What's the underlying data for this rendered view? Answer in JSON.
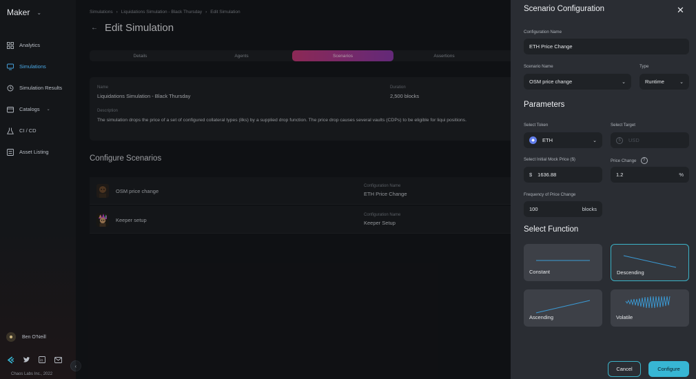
{
  "app": {
    "name": "Maker"
  },
  "sidebar": {
    "items": [
      {
        "label": "Analytics",
        "icon": "analytics-icon"
      },
      {
        "label": "Simulations",
        "icon": "monitor-icon",
        "active": true
      },
      {
        "label": "Simulation Results",
        "icon": "history-icon"
      },
      {
        "label": "Catalogs",
        "icon": "catalog-icon",
        "expandable": true
      },
      {
        "label": "CI / CD",
        "icon": "flask-icon"
      },
      {
        "label": "Asset Listing",
        "icon": "listing-icon"
      }
    ],
    "user": {
      "name": "Ben O'Neill"
    },
    "copyright": "Chaos Labs Inc., 2022"
  },
  "breadcrumb": [
    "Simulations",
    "Liquidations Simulation - Black Thursday",
    "Edit Simulation"
  ],
  "page": {
    "title": "Edit Simulation"
  },
  "tabs": [
    {
      "label": "Details"
    },
    {
      "label": "Agents"
    },
    {
      "label": "Scenarios",
      "active": true
    },
    {
      "label": "Assertions"
    }
  ],
  "details": {
    "name_label": "Name",
    "name_value": "Liquidations Simulation - Black Thursday",
    "duration_label": "Duration",
    "duration_value": "2,500 blocks",
    "description_label": "Description",
    "description_value": "The simulation drops the price of a set of configured collateral types (ilks) by a supplied drop function. The price drop causes several vaults (CDPs) to be eligible for liqui positions."
  },
  "configure_scenarios": {
    "title": "Configure Scenarios",
    "rows": [
      {
        "name": "OSM price change",
        "config_label": "Configuration Name",
        "config_value": "ETH Price Change"
      },
      {
        "name": "Keeper setup",
        "config_label": "Configuration Name",
        "config_value": "Keeper Setup"
      }
    ]
  },
  "drawer": {
    "title": "Scenario Configuration",
    "config_name_label": "Configuration Name",
    "config_name_value": "ETH Price Change",
    "scenario_name_label": "Scenario Name",
    "scenario_name_value": "OSM price change",
    "type_label": "Type",
    "type_value": "Runtime",
    "parameters_title": "Parameters",
    "select_token_label": "Select Token",
    "select_token_value": "ETH",
    "select_target_label": "Select Target",
    "select_target_placeholder": "USD",
    "initial_price_label": "Select Initial Mock Price ($)",
    "initial_price_prefix": "$",
    "initial_price_value": "1636.88",
    "price_change_label": "Price Change",
    "price_change_value": "1.2",
    "price_change_unit": "%",
    "frequency_label": "Frequency of Price Change",
    "frequency_value": "100",
    "frequency_unit": "blocks",
    "select_function_title": "Select Function",
    "functions": [
      {
        "label": "Constant"
      },
      {
        "label": "Descending",
        "selected": true
      },
      {
        "label": "Ascending"
      },
      {
        "label": "Volatile"
      }
    ],
    "cancel_label": "Cancel",
    "configure_label": "Configure"
  },
  "colors": {
    "accent": "#37b6d4",
    "active_nav": "#4aa9e6",
    "tab_gradient_start": "#c23a77",
    "tab_gradient_end": "#8a3aa8"
  }
}
